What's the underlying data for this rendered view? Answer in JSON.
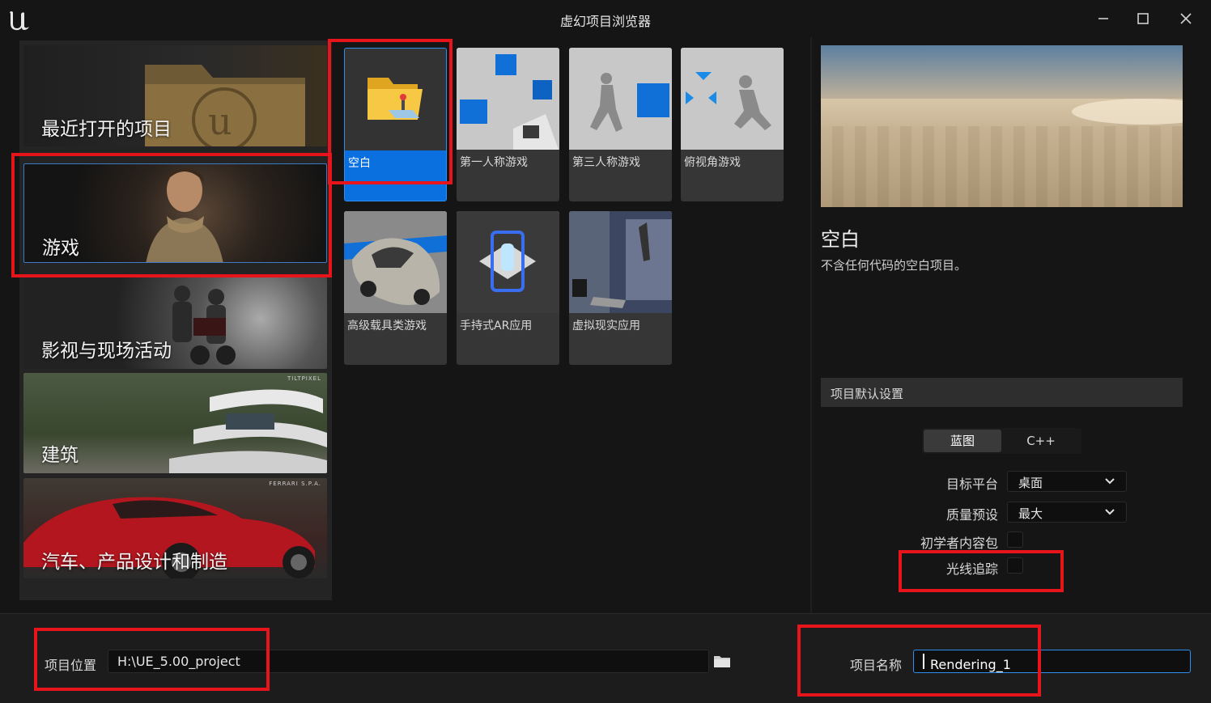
{
  "window": {
    "title": "虚幻项目浏览器"
  },
  "categories": [
    {
      "label": "最近打开的项目"
    },
    {
      "label": "游戏"
    },
    {
      "label": "影视与现场活动"
    },
    {
      "label": "建筑",
      "tag": "TILTPIXEL"
    },
    {
      "label": "汽车、产品设计和制造",
      "tag": "FERRARI S.P.A."
    }
  ],
  "templates": [
    {
      "label": "空白"
    },
    {
      "label": "第一人称游戏"
    },
    {
      "label": "第三人称游戏"
    },
    {
      "label": "俯视角游戏"
    },
    {
      "label": "高级载具类游戏"
    },
    {
      "label": "手持式AR应用"
    },
    {
      "label": "虚拟现实应用"
    }
  ],
  "details": {
    "title": "空白",
    "description": "不含任何代码的空白项目。",
    "section": "项目默认设置",
    "mode_options": [
      "蓝图",
      "C++"
    ],
    "target_platform_label": "目标平台",
    "target_platform_value": "桌面",
    "quality_label": "质量预设",
    "quality_value": "最大",
    "starter_label": "初学者内容包",
    "raytracing_label": "光线追踪"
  },
  "bottom": {
    "location_label": "项目位置",
    "location_value": "H:\\UE_5.00_project",
    "name_label": "项目名称",
    "name_value": "Rendering_1"
  }
}
